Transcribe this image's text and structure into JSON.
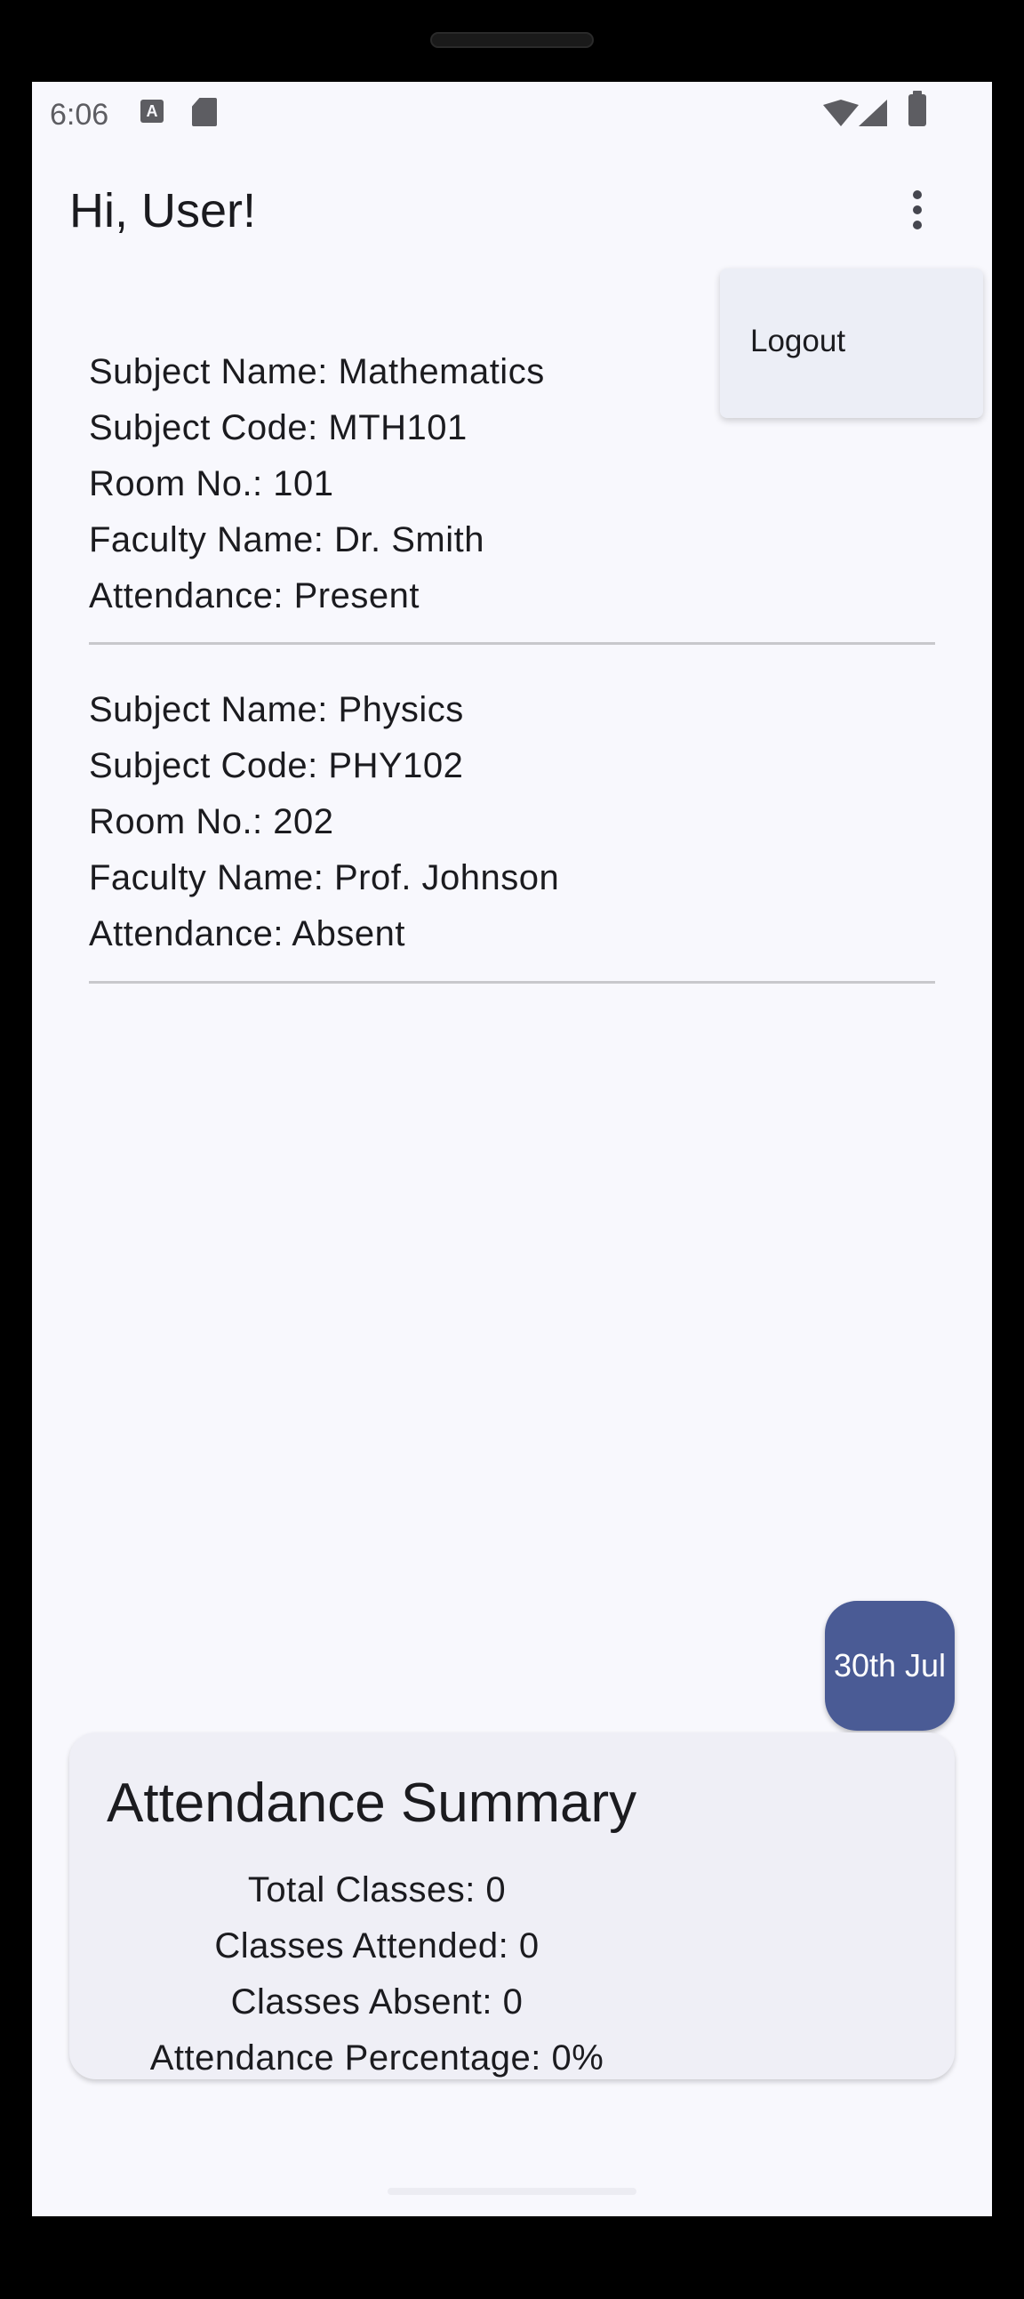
{
  "status_bar": {
    "time": "6:06",
    "icons": [
      "a-icon",
      "sd-card-icon",
      "wifi-icon",
      "signal-icon",
      "battery-icon"
    ],
    "a_icon_letter": "A"
  },
  "app_bar": {
    "title": "Hi, User!",
    "overflow_icon": "more-vert-icon"
  },
  "menu": {
    "items": [
      {
        "label": "Logout"
      }
    ]
  },
  "subjects": [
    {
      "name": "Subject Name: Mathematics",
      "code": "Subject Code: MTH101",
      "room": "Room No.: 101",
      "faculty": "Faculty Name: Dr. Smith",
      "attendance": "Attendance: Present"
    },
    {
      "name": "Subject Name: Physics",
      "code": "Subject Code: PHY102",
      "room": "Room No.: 202",
      "faculty": "Faculty Name: Prof. Johnson",
      "attendance": "Attendance: Absent"
    }
  ],
  "date_button": {
    "label": "30th Jul"
  },
  "summary": {
    "title": "Attendance Summary",
    "total_classes": "Total Classes: 0",
    "classes_attended": "Classes Attended: 0",
    "classes_absent": "Classes Absent: 0",
    "attendance_percentage": "Attendance Percentage: 0%"
  },
  "colors": {
    "background": "#f8f8fd",
    "accent": "#4a5b95",
    "card": "#efeff6",
    "menu": "#eceef6",
    "text": "#1b1b1f"
  }
}
